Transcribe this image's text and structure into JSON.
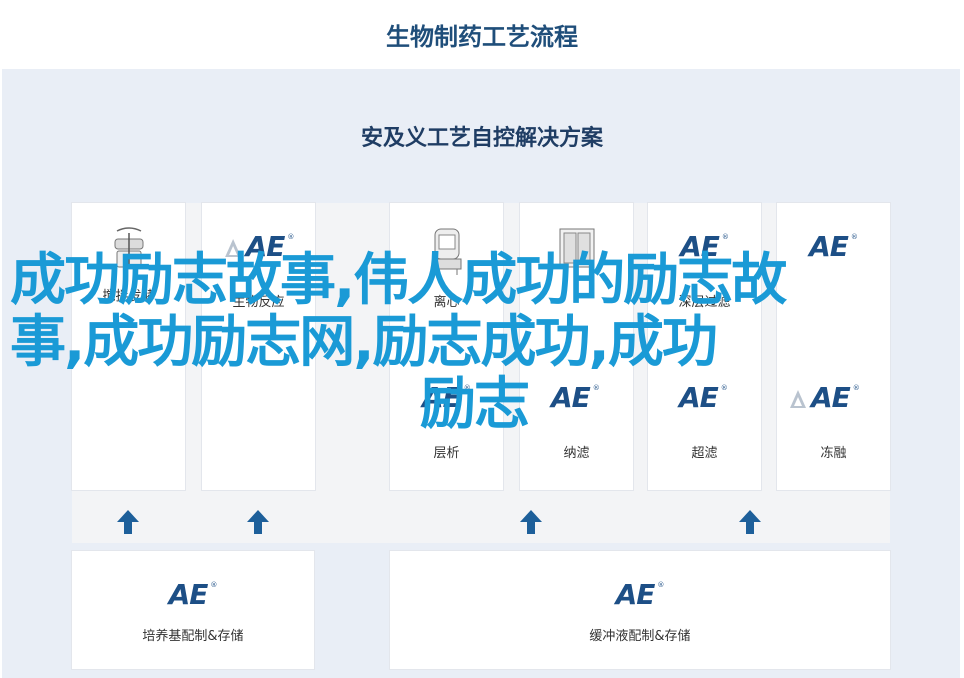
{
  "header": {
    "title": "生物制药工艺流程"
  },
  "panel": {
    "title": "安及义工艺自控解决方案"
  },
  "top_row": [
    {
      "label": "搅拌发酵",
      "icon": "stirring-fermenter-icon"
    },
    {
      "label": "生物反应",
      "icon": "ae-logo-drop-icon"
    },
    {
      "label": "离心",
      "icon": "centrifuge-icon"
    },
    {
      "label": "",
      "icon": "filter-unit-icon"
    },
    {
      "label": "深层过滤",
      "icon": "ae-logo-icon"
    },
    {
      "label": "",
      "icon": "ae-logo-icon"
    }
  ],
  "middle_row": [
    {
      "label": "层析",
      "icon": "ae-logo-icon"
    },
    {
      "label": "纳滤",
      "icon": "ae-logo-icon"
    },
    {
      "label": "超滤",
      "icon": "ae-logo-icon"
    },
    {
      "label": "冻融",
      "icon": "ae-logo-drop-icon"
    }
  ],
  "bottom_row": [
    {
      "label": "培养基配制&存储",
      "icon": "ae-logo-icon"
    },
    {
      "label": "缓冲液配制&存储",
      "icon": "ae-logo-icon"
    }
  ],
  "logo": {
    "text": "AE",
    "mark": "®"
  },
  "overlay": {
    "line1": "成功励志故事,伟人成功的励志故",
    "line2": "事,成功励志网,励志成功,成功",
    "line3": "励志"
  },
  "colors": {
    "accent": "#1d4f86",
    "overlay": "#1a9ad6",
    "arrow": "#1d5f9a"
  }
}
